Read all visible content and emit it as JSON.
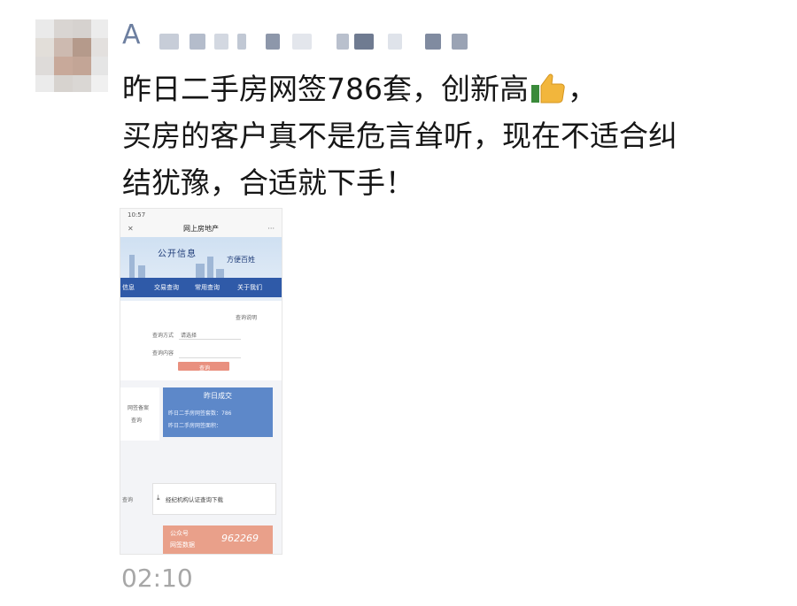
{
  "sender": {
    "name": "A"
  },
  "message": {
    "line1": "昨日二手房网签786套，创新高",
    "line1_tail": "，",
    "line2": "买房的客户真不是危言耸听，现在不适合纠",
    "line3": "结犹豫，合适就下手！",
    "emoji": "thumbs-up-icon"
  },
  "attachment": {
    "status_time": "10:57",
    "nav_title": "网上房地产",
    "nav_close": "✕",
    "nav_more": "···",
    "banner_left": "公开信息",
    "banner_right": "方便百姓",
    "menu": [
      "信息",
      "交易查询",
      "常用查询",
      "关于我们"
    ],
    "form_link": "查询说明",
    "form_label1": "查询方式",
    "form_select": "请选择",
    "form_label2": "查询内容",
    "submit": "查询",
    "panel_title": "昨日成交",
    "panel_row1": "昨日二手房网签套数：786",
    "panel_row2": "昨日二手房网签面积：",
    "side_label1": "网签备案",
    "side_label2": "查询",
    "download_left": "查询",
    "download_button": "经纪机构认证查询下载",
    "promo_line1": "公众号",
    "promo_line2": "网签数据",
    "promo_number": "962269"
  },
  "timestamp": "02:10"
}
